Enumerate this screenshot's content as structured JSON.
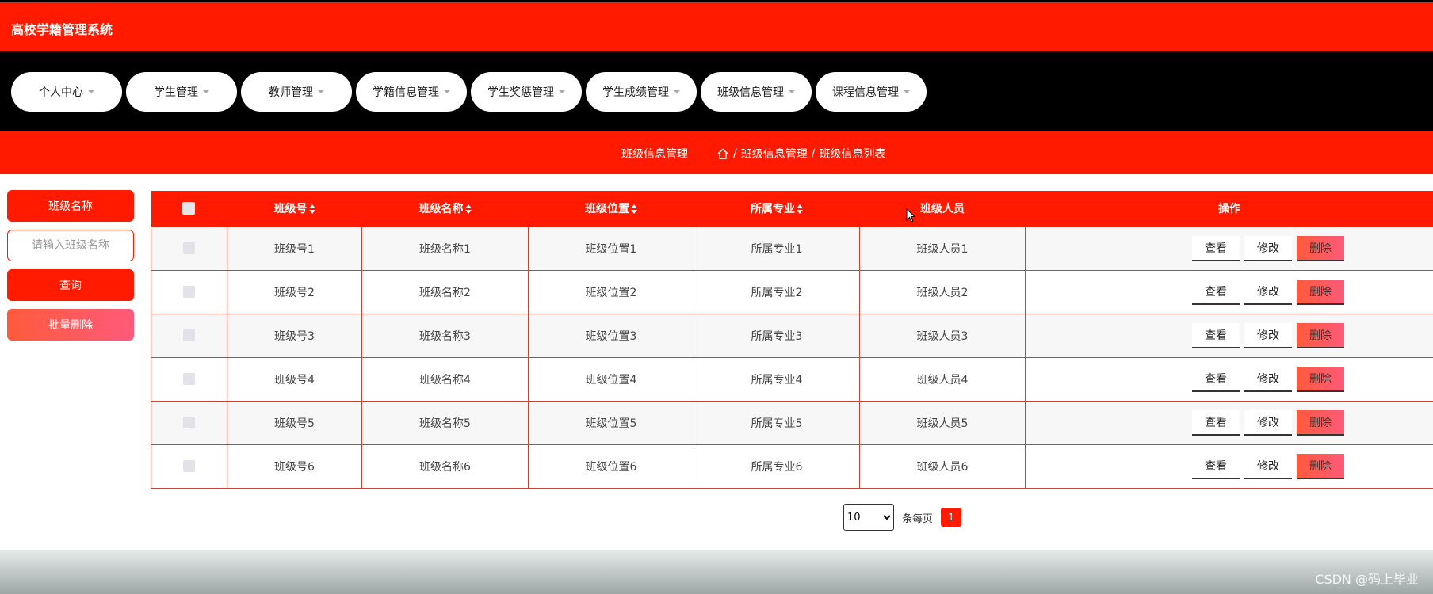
{
  "app": {
    "title": "高校学籍管理系统"
  },
  "nav": [
    {
      "label": "个人中心"
    },
    {
      "label": "学生管理"
    },
    {
      "label": "教师管理"
    },
    {
      "label": "学籍信息管理"
    },
    {
      "label": "学生奖惩管理"
    },
    {
      "label": "学生成绩管理"
    },
    {
      "label": "班级信息管理"
    },
    {
      "label": "课程信息管理"
    }
  ],
  "breadcrumb": {
    "page_title": "班级信息管理",
    "items": [
      "班级信息管理",
      "班级信息列表"
    ],
    "separator": "/"
  },
  "search": {
    "label": "班级名称",
    "placeholder": "请输入班级名称",
    "query_label": "查询",
    "batch_delete_label": "批量删除"
  },
  "table": {
    "headers": [
      "班级号",
      "班级名称",
      "班级位置",
      "所属专业",
      "班级人员",
      "操作"
    ],
    "rows": [
      [
        "班级号1",
        "班级名称1",
        "班级位置1",
        "所属专业1",
        "班级人员1"
      ],
      [
        "班级号2",
        "班级名称2",
        "班级位置2",
        "所属专业2",
        "班级人员2"
      ],
      [
        "班级号3",
        "班级名称3",
        "班级位置3",
        "所属专业3",
        "班级人员3"
      ],
      [
        "班级号4",
        "班级名称4",
        "班级位置4",
        "所属专业4",
        "班级人员4"
      ],
      [
        "班级号5",
        "班级名称5",
        "班级位置5",
        "所属专业5",
        "班级人员5"
      ],
      [
        "班级号6",
        "班级名称6",
        "班级位置6",
        "所属专业6",
        "班级人员6"
      ]
    ],
    "actions": {
      "view": "查看",
      "edit": "修改",
      "delete": "删除"
    }
  },
  "pagination": {
    "page_size": "10",
    "page_size_options": [
      "10"
    ],
    "per_page_label": "条每页",
    "current_page": "1"
  },
  "watermark": "CSDN @码上毕业",
  "colors": {
    "primary": "#ff1a00",
    "nav_bg": "#000000",
    "delete_gradient": "#ff5a3c"
  }
}
